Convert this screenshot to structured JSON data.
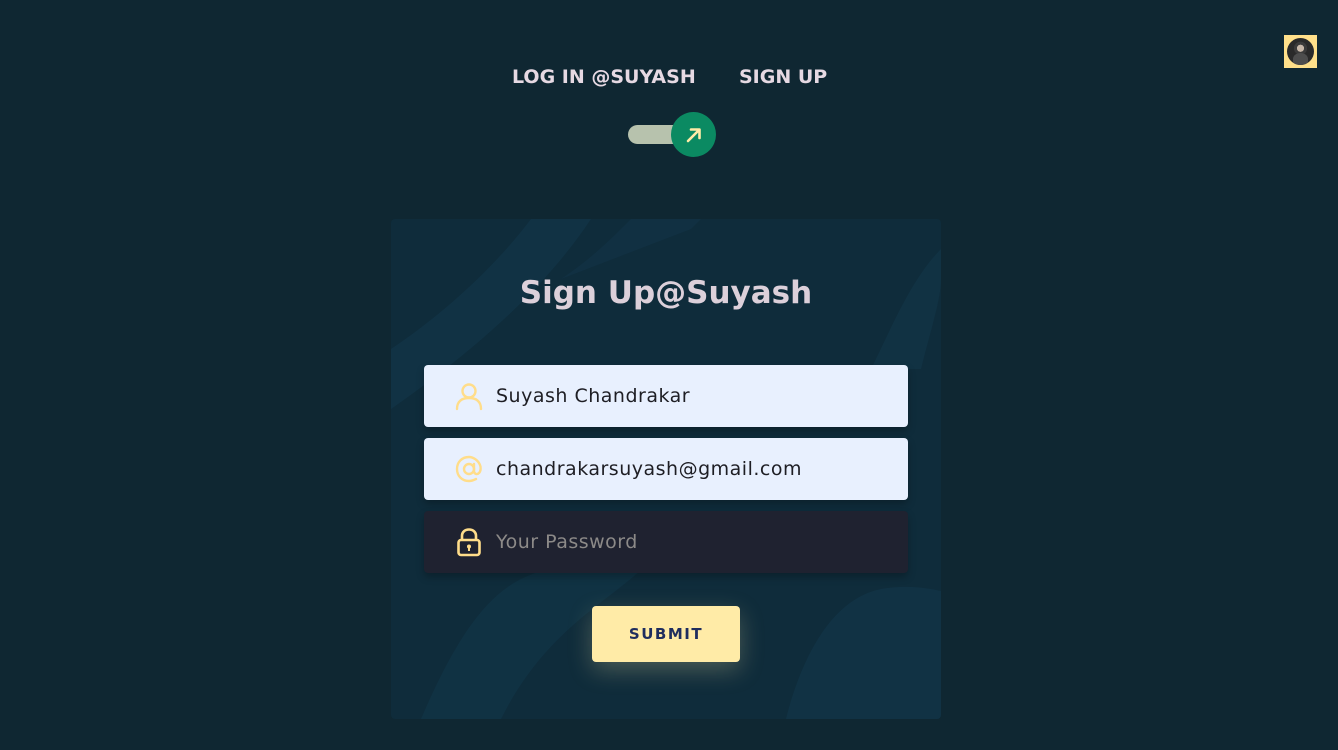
{
  "header": {
    "tab_login": "LOG IN @SUYASH",
    "tab_signup": "SIGN UP",
    "toggle_state": "signup"
  },
  "card": {
    "title": "Sign Up@Suyash",
    "name_field": {
      "value": "Suyash Chandrakar",
      "icon": "user-icon"
    },
    "email_field": {
      "value": "chandrakarsuyash@gmail.com",
      "icon": "at-sign-icon"
    },
    "password_field": {
      "value": "",
      "placeholder": "Your Password",
      "icon": "lock-icon"
    },
    "submit_label": "SUBMIT"
  },
  "colors": {
    "background": "#0f2732",
    "card": "#0f2c3b",
    "accent_yellow": "#ffeba7",
    "toggle_green": "#0b8a62",
    "input_light": "#e8f0fe",
    "input_dark": "#1f2230"
  }
}
